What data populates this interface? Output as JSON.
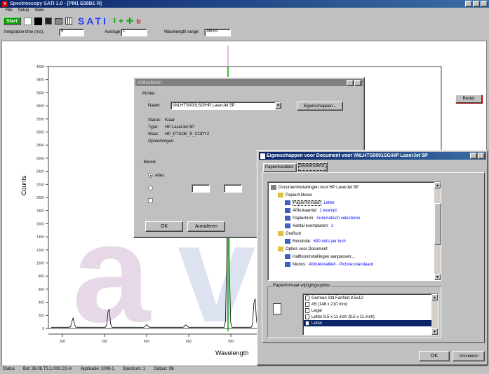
{
  "app": {
    "title": "Spectroscopy SATI 1.0 - [PM1 E08B1 R]",
    "menu": [
      "File",
      "Setup",
      "View"
    ],
    "toolbar": {
      "start_label": "Start",
      "sati_label": "SATI"
    },
    "fields": [
      {
        "label": "Integration time (ms):",
        "value": "5"
      },
      {
        "label": "Average:",
        "value": "1"
      },
      {
        "label": "Wavelength range:",
        "value": "36000"
      }
    ],
    "side_button": "Bestel",
    "status": [
      "Status",
      "Bst: 36.08.TS.1.000.CS-ln",
      "Applicatie: 2008-1",
      "Spectrum: 1",
      "Output: Ok"
    ]
  },
  "chart_data": {
    "type": "line",
    "xlabel": "Wavelength",
    "ylabel": "Counts",
    "x_ticks": [
      "300",
      "350",
      "400",
      "450",
      "500"
    ],
    "y_ticks": [
      "4000",
      "3800",
      "3600",
      "3400",
      "3200",
      "3000",
      "2800",
      "2600",
      "2400",
      "2200",
      "2000",
      "1800",
      "1600",
      "1400",
      "1200",
      "1000",
      "800",
      "600",
      "400",
      "200",
      "0"
    ],
    "ylim": [
      0,
      4000
    ],
    "peaks": [
      {
        "x": 285,
        "y": 150
      },
      {
        "x": 354,
        "y": 320
      },
      {
        "x": 400,
        "y": 40
      },
      {
        "x": 450,
        "y": 40
      },
      {
        "x": 490,
        "y": 2400
      },
      {
        "x": 525,
        "y": 500
      }
    ],
    "series_color": "#000000",
    "marker_color": "#00aa00"
  },
  "print_dialog": {
    "title": "Afdrukken",
    "printer_group": "Printer",
    "name_label": "Naam:",
    "name_value": "\\\\NLHTS0001SG\\HP LaserJet 5P",
    "props_button": "Eigenschappen...",
    "info": [
      {
        "k": "Status:",
        "v": "Klaar"
      },
      {
        "k": "Type:",
        "v": "HP LaserJet 5P"
      },
      {
        "k": "Waar:",
        "v": "HP_PTSOE_P_COPY2"
      },
      {
        "k": "Opmerkingen:",
        "v": ""
      }
    ],
    "range_group": "Bereik",
    "range_all": "Alles",
    "ok": "OK",
    "cancel": "Annuleren"
  },
  "props_dialog": {
    "title": "Eigenschappen voor Document voor \\\\NLHTS0001SG\\HP LaserJet 5P",
    "tabs": [
      "Papier/kwaliteit",
      "Geavanceerd"
    ],
    "tree": [
      {
        "indent": 0,
        "label": "Documentinstellingen voor HP LaserJet 5P",
        "link": ""
      },
      {
        "indent": 1,
        "label": "Papier/Uitvoer",
        "link": ""
      },
      {
        "indent": 2,
        "label": "Papierformaat:",
        "link": "Letter"
      },
      {
        "indent": 2,
        "label": "Afdrukaantal:",
        "link": "1 exempl"
      },
      {
        "indent": 2,
        "label": "Papierbron:",
        "link": "Automatisch selecteren"
      },
      {
        "indent": 2,
        "label": "Aantal exemplaren:",
        "link": "1"
      },
      {
        "indent": 1,
        "label": "Grafisch",
        "link": ""
      },
      {
        "indent": 2,
        "label": "Resolutie:",
        "link": "600 dots per inch"
      },
      {
        "indent": 1,
        "label": "Opties voor Document",
        "link": ""
      },
      {
        "indent": 2,
        "label": "Halftooninstellingen aanpassen...",
        "link": ""
      },
      {
        "indent": 2,
        "label": "Modus:",
        "link": "Afdrukkwaliteit - Pictoresstandaard"
      }
    ],
    "format_group": "Papierformaat wijzigingsopties",
    "formats": [
      "German Std Fanfold 8.5x12",
      "A5 (148 x 210 mm)",
      "Legal",
      "Letter 8.5 x 11 inch (8.5 x 11 inch)",
      "Letter"
    ],
    "selected_format": 4,
    "ok": "OK",
    "cancel": "Annuleren"
  }
}
